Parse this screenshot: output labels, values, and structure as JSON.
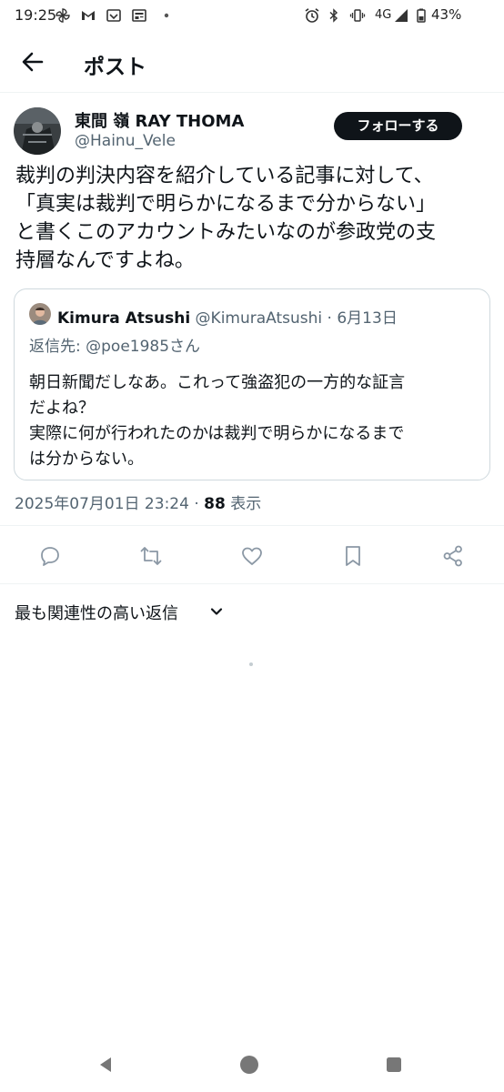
{
  "status_bar": {
    "time": "19:25",
    "network": "4G",
    "battery": "43%",
    "icons": [
      "pinwheel-icon",
      "gmail-icon",
      "inbox-icon",
      "news-icon",
      "dot-icon",
      "alarm-icon",
      "bluetooth-icon",
      "vibrate-icon",
      "signal-icon",
      "battery-icon"
    ]
  },
  "header": {
    "title": "ポスト",
    "back_icon": "arrow-left-icon"
  },
  "post": {
    "author_name": "東間 嶺 RAY THOMA",
    "author_handle": "@Hainu_Vele",
    "follow_label": "フォローする",
    "text_lines": [
      "裁判の判決内容を紹介している記事に対して、",
      "「真実は裁判で明らかになるまで分からない」",
      "と書くこのアカウントみたいなのが参政党の支",
      "持層なんですよね。"
    ],
    "quote": {
      "name": "Kimura Atsushi",
      "meta": " @KimuraAtsushi · 6月13日",
      "reply_to": "返信先: @poe1985さん",
      "body_lines": [
        "朝日新聞だしなあ。これって強盗犯の一方的な証言",
        "だよね？",
        "実際に何が行われたのかは裁判で明らかになるまで",
        "は分からない。"
      ]
    },
    "timestamp": "2025年07月01日 23:24 · ",
    "views": "88",
    "views_label": " 表示"
  },
  "actions": [
    "reply-icon",
    "retweet-icon",
    "like-icon",
    "bookmark-icon",
    "share-icon"
  ],
  "replies_sort_label": "最も関連性の高い返信",
  "nav": [
    "back-triangle-icon",
    "home-circle-icon",
    "recents-square-icon"
  ],
  "colors": {
    "text": "#0f1419",
    "secondary": "#536471",
    "border": "#cfd9de",
    "divider": "#eff3f4",
    "button_bg": "#0f1419"
  }
}
